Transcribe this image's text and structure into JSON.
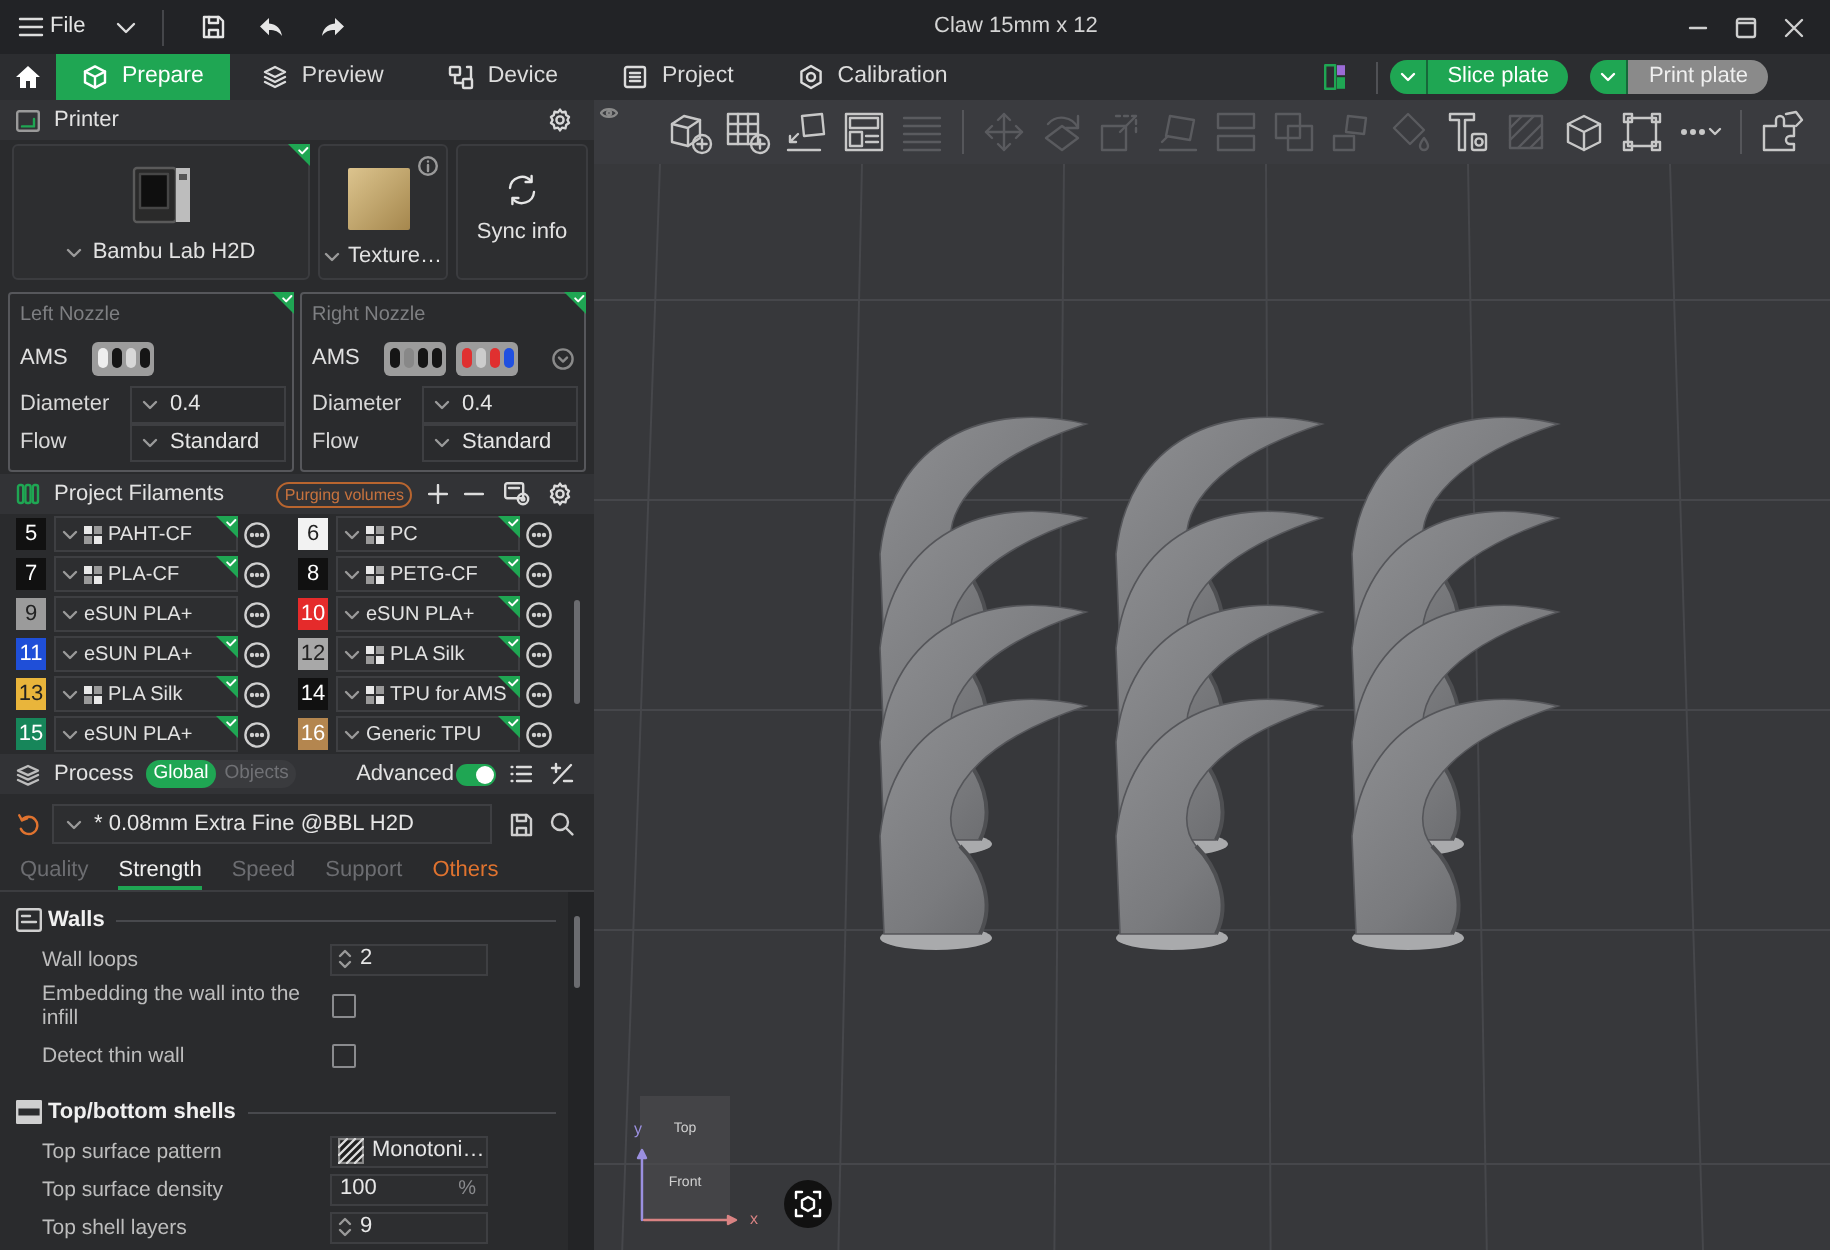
{
  "window": {
    "title": "Claw 15mm x 12",
    "menu": "File"
  },
  "main_tabs": [
    {
      "label": "Prepare",
      "selected": true
    },
    {
      "label": "Preview",
      "selected": false
    },
    {
      "label": "Device",
      "selected": false
    },
    {
      "label": "Project",
      "selected": false
    },
    {
      "label": "Calibration",
      "selected": false
    }
  ],
  "plate_actions": [
    {
      "label": "Slice plate",
      "disabled": false
    },
    {
      "label": "Print plate",
      "disabled": true
    }
  ],
  "printer": {
    "title": "Printer",
    "model": "Bambu Lab H2D",
    "synced": true,
    "plate": "Texture…",
    "sync_button": "Sync info"
  },
  "nozzles": [
    {
      "title": "Left Nozzle",
      "synced": true,
      "ams_label": "AMS",
      "ams_units": [
        {
          "slots": [
            {
              "color": "#eeeeee"
            },
            {
              "color": "#151515"
            },
            {
              "color": "#d8d8d8"
            },
            {
              "color": "#151515"
            }
          ]
        }
      ],
      "expand_button": false,
      "fields": [
        {
          "label": "Diameter",
          "value": "0.4"
        },
        {
          "label": "Flow",
          "value": "Standard"
        }
      ]
    },
    {
      "title": "Right Nozzle",
      "synced": true,
      "ams_label": "AMS",
      "ams_units": [
        {
          "slots": [
            {
              "color": "#151515"
            },
            {
              "color": "#888888"
            },
            {
              "color": "#151515"
            },
            {
              "color": "#151515"
            }
          ]
        },
        {
          "slots": [
            {
              "color": "#e03030"
            },
            {
              "color": "#cccccc"
            },
            {
              "color": "#e03030"
            },
            {
              "color": "#2050e0"
            }
          ]
        }
      ],
      "expand_button": true,
      "fields": [
        {
          "label": "Diameter",
          "value": "0.4"
        },
        {
          "label": "Flow",
          "value": "Standard"
        }
      ]
    }
  ],
  "filaments_panel": {
    "title": "Project Filaments",
    "purge_button": "Purging volumes"
  },
  "filaments": [
    {
      "number": "5",
      "color": "#111111",
      "name": "PAHT-CF",
      "preset_icon": true,
      "synced": true
    },
    {
      "number": "6",
      "color": "#f2f2f2",
      "name": "PC",
      "preset_icon": true,
      "synced": true
    },
    {
      "number": "7",
      "color": "#111111",
      "name": "PLA-CF",
      "preset_icon": true,
      "synced": true
    },
    {
      "number": "8",
      "color": "#111111",
      "name": "PETG-CF",
      "preset_icon": true,
      "synced": true
    },
    {
      "number": "9",
      "color": "#9b9b9b",
      "name": "eSUN PLA+",
      "preset_icon": false,
      "synced": false
    },
    {
      "number": "10",
      "color": "#e52b2b",
      "name": "eSUN PLA+",
      "preset_icon": false,
      "synced": true
    },
    {
      "number": "11",
      "color": "#1f4fd8",
      "name": "eSUN PLA+",
      "preset_icon": false,
      "synced": true
    },
    {
      "number": "12",
      "color": "#a8a8a8",
      "name": "PLA Silk",
      "preset_icon": true,
      "synced": true
    },
    {
      "number": "13",
      "color": "#e9b53b",
      "name": "PLA Silk",
      "preset_icon": true,
      "synced": true
    },
    {
      "number": "14",
      "color": "#111111",
      "name": "TPU for AMS",
      "preset_icon": true,
      "synced": true
    },
    {
      "number": "15",
      "color": "#17865a",
      "name": "eSUN PLA+",
      "preset_icon": false,
      "synced": true
    },
    {
      "number": "16",
      "color": "#b4864f",
      "name": "Generic TPU",
      "preset_icon": false,
      "synced": true
    }
  ],
  "process": {
    "title": "Process",
    "scope": [
      {
        "label": "Global",
        "selected": true
      },
      {
        "label": "Objects",
        "selected": false
      }
    ],
    "advanced": {
      "label": "Advanced",
      "on": true
    },
    "preset": {
      "value": "* 0.08mm Extra Fine @BBL H2D",
      "modified": true
    },
    "tabs": [
      {
        "label": "Quality",
        "selected": false,
        "modified": false
      },
      {
        "label": "Strength",
        "selected": true,
        "modified": false
      },
      {
        "label": "Speed",
        "selected": false,
        "modified": false
      },
      {
        "label": "Support",
        "selected": false,
        "modified": false
      },
      {
        "label": "Others",
        "selected": false,
        "modified": true
      }
    ],
    "groups": [
      {
        "title": "Walls",
        "settings": [
          {
            "kind": "spin",
            "label": "Wall loops",
            "value": "2"
          },
          {
            "kind": "checkbox",
            "label": "Embedding the wall into the infill",
            "checked": false
          },
          {
            "kind": "checkbox",
            "label": "Detect thin wall",
            "checked": false
          }
        ]
      },
      {
        "title": "Top/bottom shells",
        "settings": [
          {
            "kind": "pattern",
            "label": "Top surface pattern",
            "value": "Monotoni…"
          },
          {
            "kind": "unit",
            "label": "Top surface density",
            "value": "100",
            "unit": "%"
          },
          {
            "kind": "spin",
            "label": "Top shell layers",
            "value": "9"
          }
        ]
      }
    ]
  },
  "toolbar": [
    {
      "disabled": false
    },
    {
      "disabled": false
    },
    {
      "disabled": false
    },
    {
      "disabled": false
    },
    {
      "disabled": true
    },
    {
      "disabled": true
    },
    {
      "disabled": true
    },
    {
      "disabled": true
    },
    {
      "disabled": true
    },
    {
      "disabled": true
    },
    {
      "disabled": true
    },
    {
      "disabled": true
    },
    {
      "disabled": true
    },
    {
      "disabled": false
    },
    {
      "disabled": true
    },
    {
      "disabled": false
    },
    {
      "disabled": false
    },
    {
      "disabled": false
    },
    {
      "disabled": false
    }
  ],
  "viewport": {
    "view_cube": {
      "top": "Top",
      "front": "Front"
    },
    "axes": {
      "y": "y",
      "x": "x"
    }
  }
}
